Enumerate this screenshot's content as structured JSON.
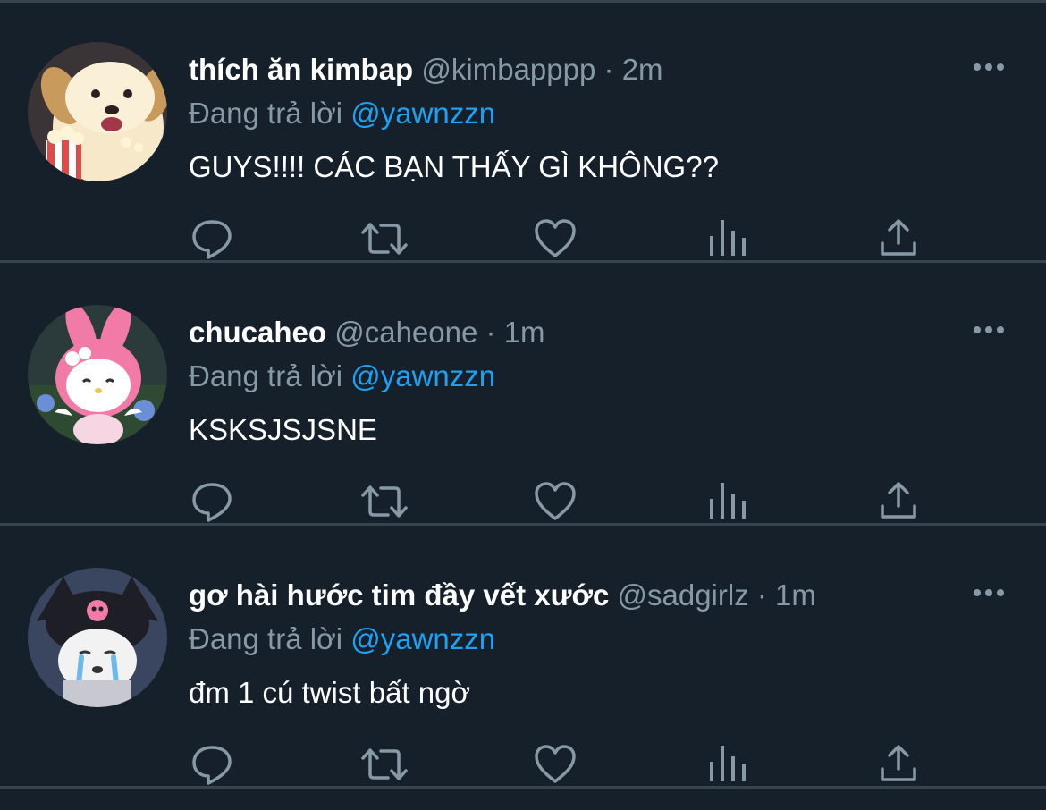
{
  "colors": {
    "background": "#15202b",
    "divider": "#38444d",
    "secondary_text": "#8899a6",
    "link": "#1da1f2"
  },
  "tweets": [
    {
      "display_name": "thích ăn kimbap",
      "handle": "@kimbapppp",
      "separator": "·",
      "time": "2m",
      "reply_prefix": "Đang trả lời",
      "reply_to": "@yawnzzn",
      "text": "GUYS!!!! CÁC BẠN THẤY GÌ KHÔNG??",
      "avatar_icon": "dog-with-popcorn-avatar"
    },
    {
      "display_name": "chucaheo",
      "handle": "@caheone",
      "separator": "·",
      "time": "1m",
      "reply_prefix": "Đang trả lời",
      "reply_to": "@yawnzzn",
      "text": "KSKSJSJSNE",
      "avatar_icon": "my-melody-avatar"
    },
    {
      "display_name": "gơ hài hước tim đầy vết xước",
      "handle": "@sadgirlz",
      "separator": "·",
      "time": "1m",
      "reply_prefix": "Đang trả lời",
      "reply_to": "@yawnzzn",
      "text": "đm 1 cú twist bất ngờ",
      "avatar_icon": "kuromi-crying-avatar"
    }
  ],
  "action_icons": [
    "reply-icon",
    "retweet-icon",
    "like-icon",
    "analytics-icon",
    "share-icon"
  ],
  "more_icon": "more-options-icon"
}
